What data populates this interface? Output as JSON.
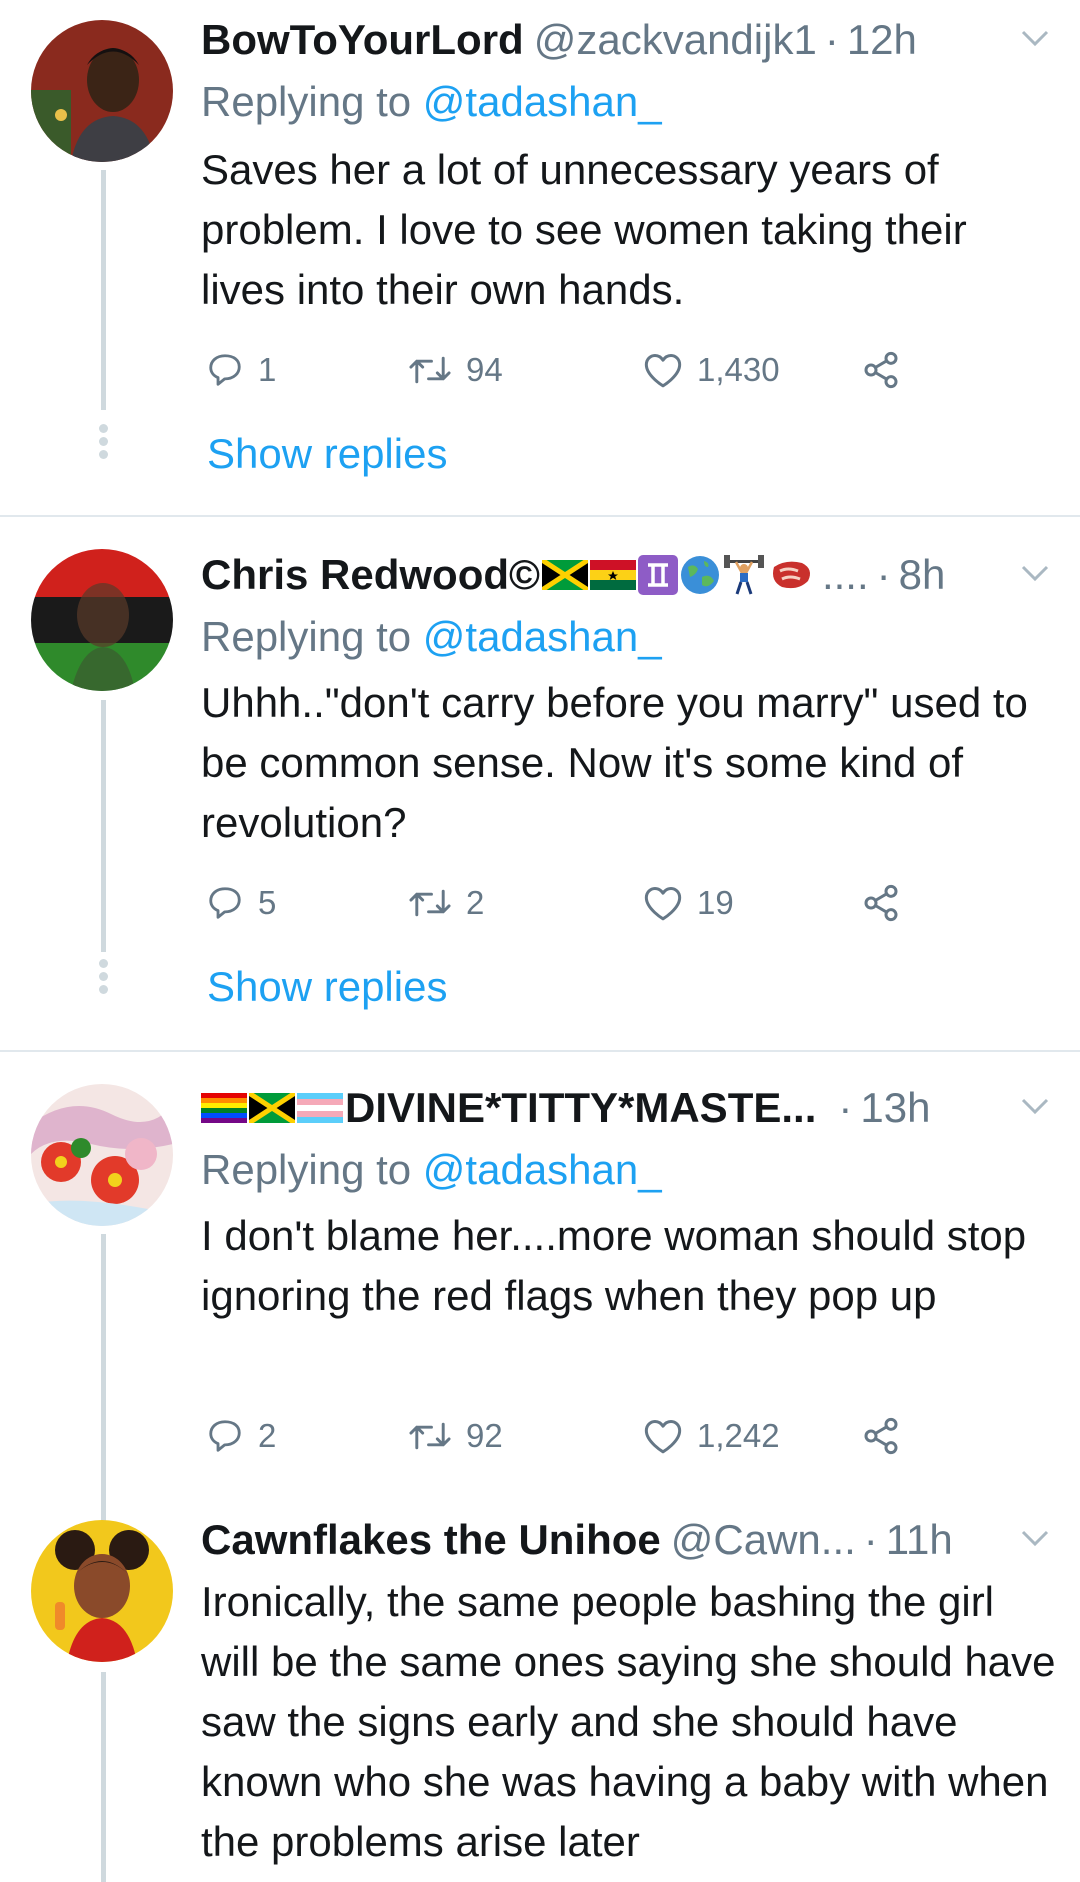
{
  "tweets": [
    {
      "name": "BowToYourLord",
      "handle": "@zackvandijk1",
      "time": "12h",
      "replying_prefix": "Replying to ",
      "replying_to": "@tadashan_",
      "text": "Saves her a lot of unnecessary years of problem. I love to see women taking their lives into their own hands.",
      "replies": "1",
      "retweets": "94",
      "likes": "1,430",
      "show_replies": "Show replies"
    },
    {
      "name": "Chris Redwood©",
      "name_suffix": "....",
      "time": "8h",
      "replying_prefix": "Replying to ",
      "replying_to": "@tadashan_",
      "text": "Uhhh..\"don't carry before you marry\" used to be common sense. Now it's some kind of revolution?",
      "replies": "5",
      "retweets": "2",
      "likes": "19",
      "show_replies": "Show replies"
    },
    {
      "name": "DIVINE*TITTY*MASTE...",
      "time": "13h",
      "replying_prefix": "Replying to ",
      "replying_to": "@tadashan_",
      "text": "I don't blame her....more woman should stop ignoring the red flags when they pop up",
      "replies": "2",
      "retweets": "92",
      "likes": "1,242"
    },
    {
      "name": "Cawnflakes the Unihoe",
      "handle": "@Cawn...",
      "time": "11h",
      "text": "Ironically, the same people bashing the girl will be the same ones saying she should have saw the signs early and she should have known who she was having a baby with when the problems arise later"
    }
  ],
  "separator": "·",
  "icons": {
    "reply": "reply-icon",
    "retweet": "retweet-icon",
    "like": "heart-icon",
    "share": "share-icon",
    "menu": "chevron-down-icon"
  },
  "colors": {
    "link": "#1da1f2",
    "secondary_text": "#657786",
    "primary_text": "#14171a",
    "thread_line": "#cfd9de",
    "divider": "#e1e8ed"
  }
}
